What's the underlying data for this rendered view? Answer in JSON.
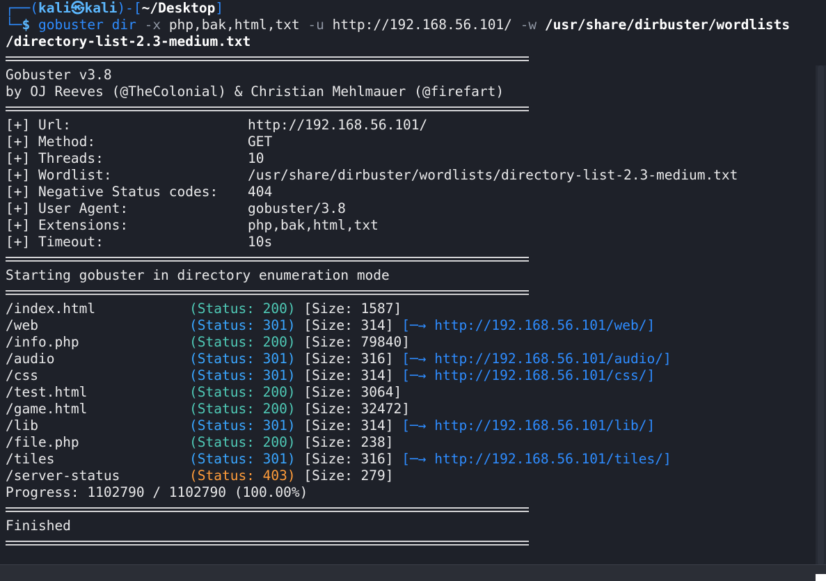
{
  "prompt": {
    "line1_prefix": "┌──(",
    "user": "kali",
    "at": "㉿",
    "host": "kali",
    "mid": ")-[",
    "cwd": "~/Desktop",
    "close": "]",
    "line2_prefix": "└─",
    "dollar": "$ ",
    "cmd": "gobuster",
    "cmd_sub": " dir ",
    "flag_x": "-x",
    "ext_arg": " php,bak,html,txt ",
    "flag_u": "-u",
    "url_arg": " http://192.168.56.101/ ",
    "flag_w": "-w",
    "wordlist_arg_a": " /usr/share/dirbuster/wordlists",
    "wordlist_arg_b": "/directory-list-2.3-medium.txt"
  },
  "banner": {
    "title": "Gobuster v3.8",
    "authors": "by OJ Reeves (@TheColonial) & Christian Mehlmauer (@firefart)"
  },
  "config": [
    {
      "key": "[+] Url:",
      "value": "http://192.168.56.101/"
    },
    {
      "key": "[+] Method:",
      "value": "GET"
    },
    {
      "key": "[+] Threads:",
      "value": "10"
    },
    {
      "key": "[+] Wordlist:",
      "value": "/usr/share/dirbuster/wordlists/directory-list-2.3-medium.txt"
    },
    {
      "key": "[+] Negative Status codes:",
      "value": "404"
    },
    {
      "key": "[+] User Agent:",
      "value": "gobuster/3.8"
    },
    {
      "key": "[+] Extensions:",
      "value": "php,bak,html,txt"
    },
    {
      "key": "[+] Timeout:",
      "value": "10s"
    }
  ],
  "start_msg": "Starting gobuster in directory enumeration mode",
  "results": [
    {
      "path": "/index.html",
      "status": "(Status: 200)",
      "size": "[Size: 1587]",
      "redirect": ""
    },
    {
      "path": "/web",
      "status": "(Status: 301)",
      "size": "[Size: 314]",
      "redirect": "[─→ http://192.168.56.101/web/]"
    },
    {
      "path": "/info.php",
      "status": "(Status: 200)",
      "size": "[Size: 79840]",
      "redirect": ""
    },
    {
      "path": "/audio",
      "status": "(Status: 301)",
      "size": "[Size: 316]",
      "redirect": "[─→ http://192.168.56.101/audio/]"
    },
    {
      "path": "/css",
      "status": "(Status: 301)",
      "size": "[Size: 314]",
      "redirect": "[─→ http://192.168.56.101/css/]"
    },
    {
      "path": "/test.html",
      "status": "(Status: 200)",
      "size": "[Size: 3064]",
      "redirect": ""
    },
    {
      "path": "/game.html",
      "status": "(Status: 200)",
      "size": "[Size: 32472]",
      "redirect": ""
    },
    {
      "path": "/lib",
      "status": "(Status: 301)",
      "size": "[Size: 314]",
      "redirect": "[─→ http://192.168.56.101/lib/]"
    },
    {
      "path": "/file.php",
      "status": "(Status: 200)",
      "size": "[Size: 238]",
      "redirect": ""
    },
    {
      "path": "/tiles",
      "status": "(Status: 301)",
      "size": "[Size: 316]",
      "redirect": "[─→ http://192.168.56.101/tiles/]"
    },
    {
      "path": "/server-status",
      "status": "(Status: 403)",
      "size": "[Size: 279]",
      "redirect": ""
    }
  ],
  "progress": "Progress: 1102790 / 1102790 (100.00%)",
  "finished": "Finished",
  "colors": {
    "background": "#1e2129",
    "status_200": "#4fc9b6",
    "status_301": "#3aa6ff",
    "status_403": "#ff9c3a",
    "prompt_blue": "#2e8cff"
  }
}
